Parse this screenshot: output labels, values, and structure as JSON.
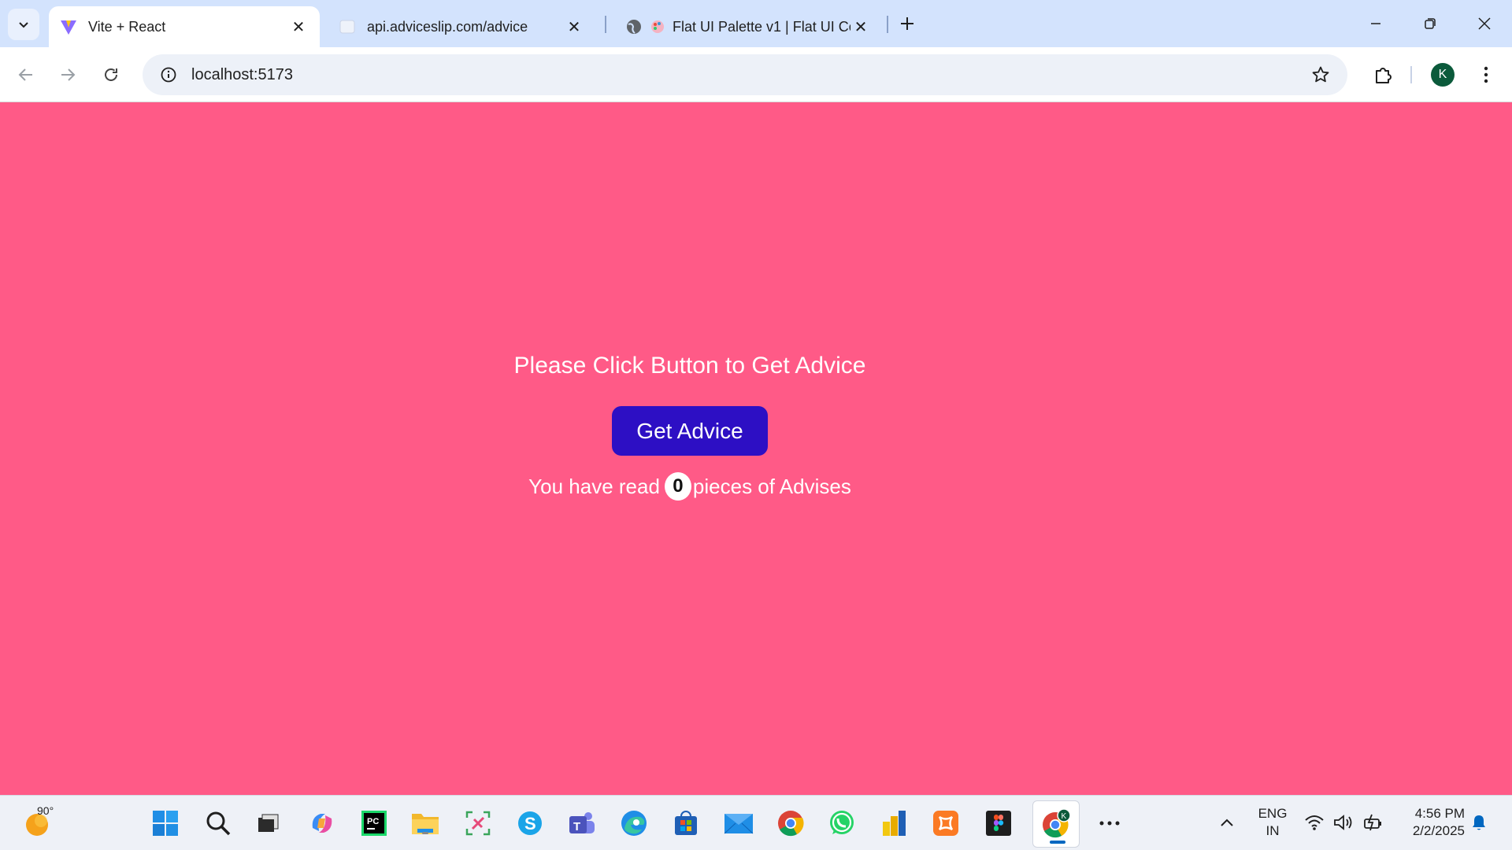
{
  "browser": {
    "tabs": [
      {
        "title": "Vite + React",
        "icon": "vite-logo-icon",
        "active": true
      },
      {
        "title": "api.adviceslip.com/advice",
        "icon": "blank-page-icon",
        "active": false
      },
      {
        "title": "Flat UI Palette v1 | Flat UI Co",
        "icon": "palette-icon",
        "active": false
      }
    ],
    "address": "localhost:5173",
    "profile_initial": "K"
  },
  "page": {
    "headline": "Please Click Button to Get Advice",
    "button_label": "Get Advice",
    "counter_prefix": "You have read",
    "counter_value": "0",
    "counter_suffix": "pieces of Advises",
    "background_color": "#ff5a87",
    "button_color": "#2d0fc4"
  },
  "taskbar": {
    "weather_temp": "90°",
    "apps": [
      "start",
      "search",
      "task-view",
      "copilot",
      "pycharm",
      "file-explorer",
      "snipping-tool",
      "skype",
      "teams",
      "edge",
      "microsoft-store",
      "mail",
      "chrome",
      "whatsapp",
      "power-bi",
      "xampp",
      "figma",
      "chrome-active",
      "more"
    ],
    "language_line1": "ENG",
    "language_line2": "IN",
    "time": "4:56 PM",
    "date": "2/2/2025"
  }
}
